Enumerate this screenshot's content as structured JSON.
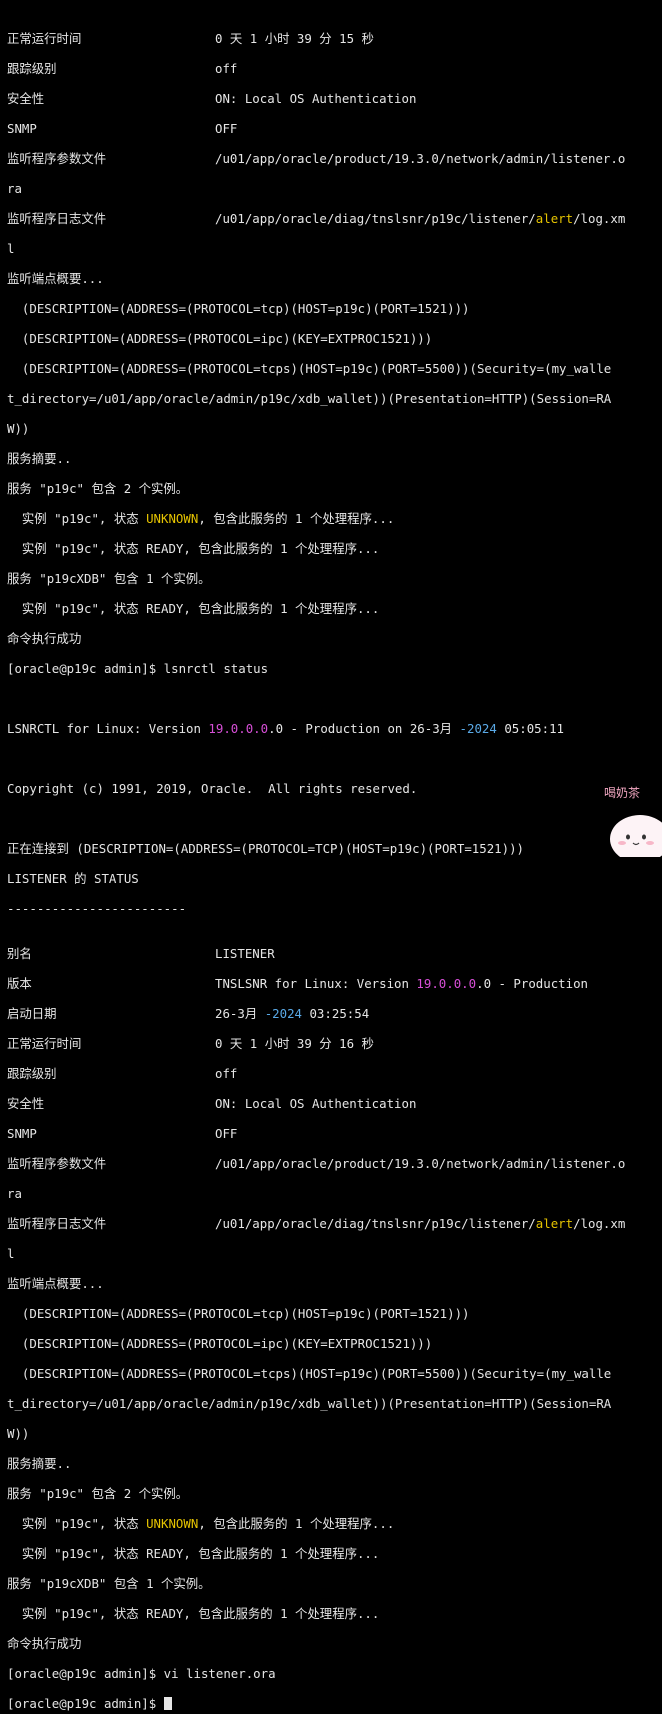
{
  "colors": {
    "background": "#000000",
    "text": "#e6e6e6",
    "unknown_status": "#e5c300",
    "version_number": "#d64fd6",
    "year_number": "#5aa9e6"
  },
  "block1": {
    "uptime_label": "正常运行时间",
    "uptime_value": "0 天 1 小时 39 分 15 秒",
    "trace_label": "跟踪级别",
    "trace_value": "off",
    "security_label": "安全性",
    "security_value": "ON: Local OS Authentication",
    "snmp_label": "SNMP",
    "snmp_value": "OFF",
    "param_label": "监听程序参数文件",
    "param_value_a": "/u01/app/oracle/product/19.3.0/network/admin/listener.o",
    "param_value_b": "ra",
    "log_label": "监听程序日志文件",
    "log_value_prefix": "/u01/app/oracle/diag/tnslsnr/p19c/listener/",
    "log_value_word": "alert",
    "log_value_suffix": "/log.xm",
    "log_value_b": "l",
    "endpoints_title": "监听端点概要...",
    "endpoint_1": "  (DESCRIPTION=(ADDRESS=(PROTOCOL=tcp)(HOST=p19c)(PORT=1521)))",
    "endpoint_2": "  (DESCRIPTION=(ADDRESS=(PROTOCOL=ipc)(KEY=EXTPROC1521)))",
    "endpoint_3a": "  (DESCRIPTION=(ADDRESS=(PROTOCOL=tcps)(HOST=p19c)(PORT=5500))(Security=(my_walle",
    "endpoint_3b": "t_directory=/u01/app/oracle/admin/p19c/xdb_wallet))(Presentation=HTTP)(Session=RA",
    "endpoint_3c": "W))",
    "services_title": "服务摘要..",
    "svc1": "服务 \"p19c\" 包含 2 个实例。",
    "svc1_inst1_prefix": "  实例 \"p19c\", 状态 ",
    "svc1_inst1_status": "UNKNOWN",
    "svc1_inst1_suffix": ", 包含此服务的 1 个处理程序...",
    "svc1_inst2": "  实例 \"p19c\", 状态 READY, 包含此服务的 1 个处理程序...",
    "svc2": "服务 \"p19cXDB\" 包含 1 个实例。",
    "svc2_inst1": "  实例 \"p19c\", 状态 READY, 包含此服务的 1 个处理程序...",
    "done": "命令执行成功"
  },
  "prompt1": "[oracle@p19c admin]$ lsnrctl status",
  "banner": {
    "prefix": "LSNRCTL for Linux: Version ",
    "version": "19.0.0.0",
    "mid": ".0 - Production on 26-3月 ",
    "year": "-2024",
    "time": " 05:05:11"
  },
  "copyright": "Copyright (c) 1991, 2019, Oracle.  All rights reserved.",
  "connecting": "正在连接到 (DESCRIPTION=(ADDRESS=(PROTOCOL=TCP)(HOST=p19c)(PORT=1521)))",
  "status_title": "LISTENER 的 STATUS",
  "separator": "------------------------",
  "block2": {
    "alias_label": "别名",
    "alias_value": "LISTENER",
    "version_label": "版本",
    "version_prefix": "TNSLSNR for Linux: Version ",
    "version_number": "19.0.0.0",
    "version_suffix": ".0 - Production",
    "start_label": "启动日期",
    "start_prefix": "26-3月 ",
    "start_year": "-2024",
    "start_time": " 03:25:54",
    "uptime_label": "正常运行时间",
    "uptime_value": "0 天 1 小时 39 分 16 秒",
    "trace_label": "跟踪级别",
    "trace_value": "off",
    "security_label": "安全性",
    "security_value": "ON: Local OS Authentication",
    "snmp_label": "SNMP",
    "snmp_value": "OFF",
    "param_label": "监听程序参数文件",
    "param_value_a": "/u01/app/oracle/product/19.3.0/network/admin/listener.o",
    "param_value_b": "ra",
    "log_label": "监听程序日志文件",
    "log_value_prefix": "/u01/app/oracle/diag/tnslsnr/p19c/listener/",
    "log_value_word": "alert",
    "log_value_suffix": "/log.xm",
    "log_value_b": "l",
    "endpoints_title": "监听端点概要...",
    "endpoint_1": "  (DESCRIPTION=(ADDRESS=(PROTOCOL=tcp)(HOST=p19c)(PORT=1521)))",
    "endpoint_2": "  (DESCRIPTION=(ADDRESS=(PROTOCOL=ipc)(KEY=EXTPROC1521)))",
    "endpoint_3a": "  (DESCRIPTION=(ADDRESS=(PROTOCOL=tcps)(HOST=p19c)(PORT=5500))(Security=(my_walle",
    "endpoint_3b": "t_directory=/u01/app/oracle/admin/p19c/xdb_wallet))(Presentation=HTTP)(Session=RA",
    "endpoint_3c": "W))",
    "services_title": "服务摘要..",
    "svc1": "服务 \"p19c\" 包含 2 个实例。",
    "svc1_inst1_prefix": "  实例 \"p19c\", 状态 ",
    "svc1_inst1_status": "UNKNOWN",
    "svc1_inst1_suffix": ", 包含此服务的 1 个处理程序...",
    "svc1_inst2": "  实例 \"p19c\", 状态 READY, 包含此服务的 1 个处理程序...",
    "svc2": "服务 \"p19cXDB\" 包含 1 个实例。",
    "svc2_inst1": "  实例 \"p19c\", 状态 READY, 包含此服务的 1 个处理程序...",
    "done": "命令执行成功"
  },
  "prompt2": "[oracle@p19c admin]$ vi listener.ora",
  "prompt3": "[oracle@p19c admin]$ ",
  "watermark_text": "喝奶茶"
}
